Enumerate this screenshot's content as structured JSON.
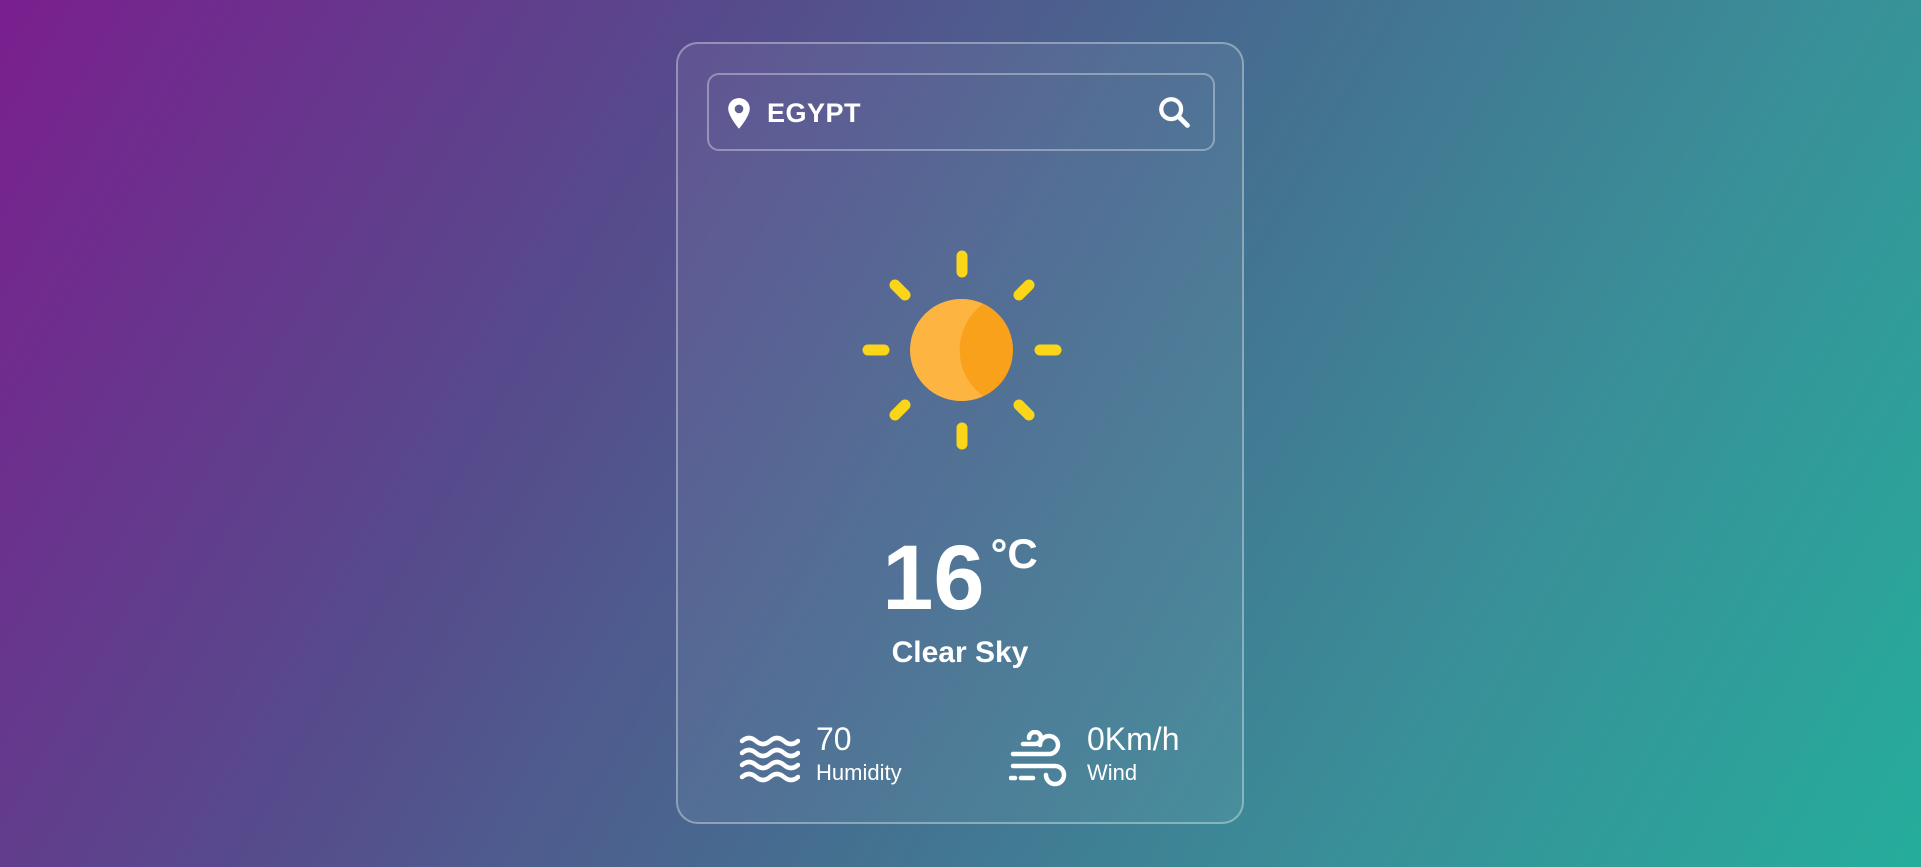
{
  "search": {
    "value": "EGYPT",
    "pin_icon": "map-pin-icon",
    "search_icon": "search-icon"
  },
  "weather": {
    "icon": "sun-icon",
    "temperature": "16",
    "unit": "°C",
    "description": "Clear Sky"
  },
  "details": {
    "humidity": {
      "icon": "water-waves-icon",
      "value": "70",
      "label": "Humidity"
    },
    "wind": {
      "icon": "wind-icon",
      "value": "0Km/h",
      "label": "Wind"
    }
  },
  "colors": {
    "sun_body": "#fdb441",
    "sun_shade": "#f9a11b",
    "sun_rays": "#fbd518",
    "text": "#ffffff",
    "gradient_start": "#7a1f8e",
    "gradient_end": "#25ad9b"
  }
}
